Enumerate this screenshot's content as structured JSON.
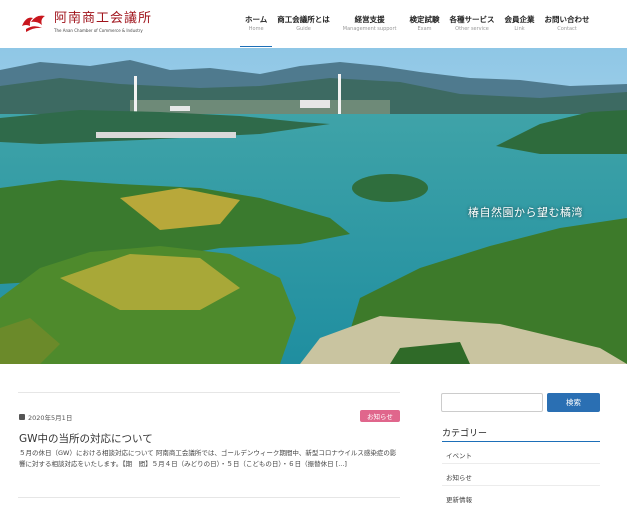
{
  "brand": {
    "name": "阿南商工会議所",
    "subtitle": "The Anan Chamber of Commerce & Industry",
    "accent_color": "#a0141c"
  },
  "nav": {
    "items": [
      {
        "label": "ホーム",
        "sub": "Home",
        "active": true
      },
      {
        "label": "商工会議所とは",
        "sub": "Guide"
      },
      {
        "label": "経営支援",
        "sub": "Management support"
      },
      {
        "label": "検定試験",
        "sub": "Exam"
      },
      {
        "label": "各種サービス",
        "sub": "Other service"
      },
      {
        "label": "会員企業",
        "sub": "Link"
      },
      {
        "label": "お問い合わせ",
        "sub": "Contact"
      }
    ]
  },
  "hero": {
    "caption": "椿自然園から望む橘湾"
  },
  "post": {
    "date": "2020年5月1日",
    "category": "お知らせ",
    "category_color": "#e0668c",
    "title": "GW中の当所の対応について",
    "excerpt": "５月の休日（GW）における相談対応について 阿南商工会議所では、ゴールデンウィーク期間中、新型コロナウイルス感染症の影響に対する相談対応をいたします。【期　間】５月４日（みどりの日）・５日（こどもの日）・６日（振替休日 [...]"
  },
  "sidebar": {
    "search_button": "検索",
    "search_placeholder": "",
    "categories_title": "カテゴリー",
    "categories": [
      "イベント",
      "お知らせ",
      "更新情報"
    ],
    "accent_color": "#2a6fb3"
  }
}
